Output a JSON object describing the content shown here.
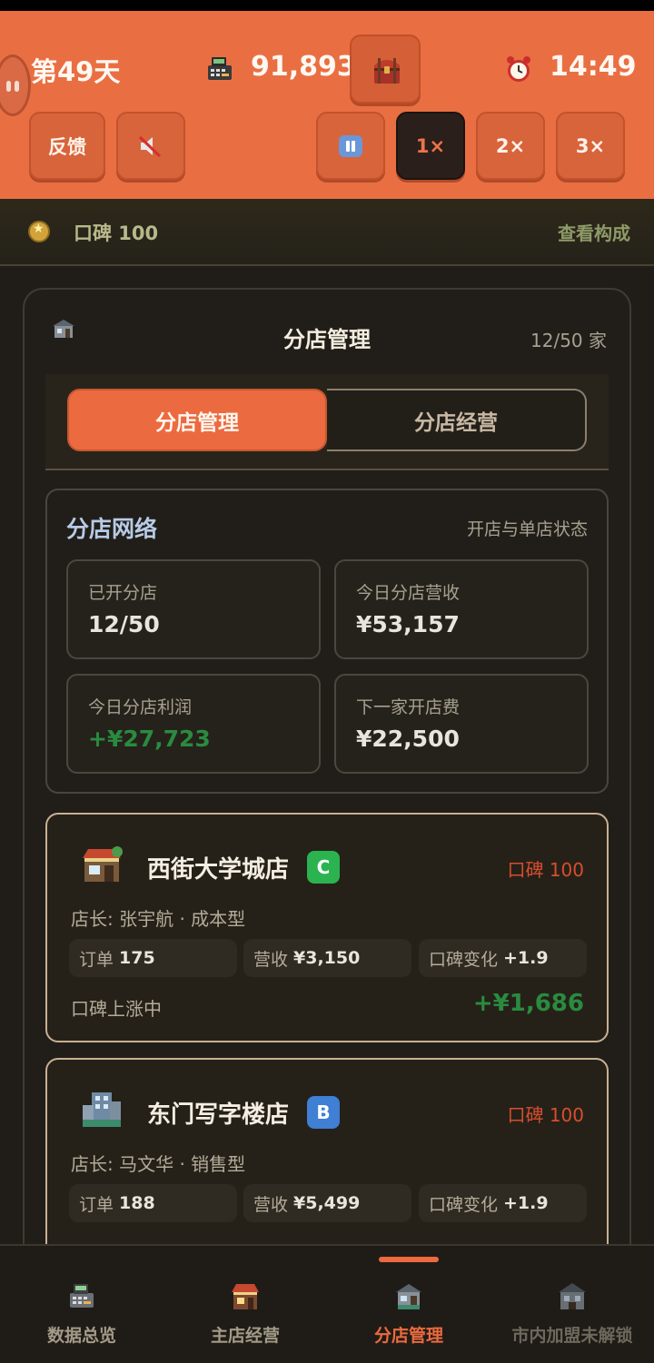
{
  "header": {
    "day": "第49天",
    "money": "91,893",
    "time": "14:49",
    "feedback_label": "反馈",
    "speed_1x": "1×",
    "speed_2x": "2×",
    "speed_3x": "3×"
  },
  "reputation": {
    "label": "口碑 100",
    "link": "查看构成"
  },
  "panel": {
    "title": "分店管理",
    "count": "12/50 家",
    "tabs": [
      "分店管理",
      "分店经营"
    ]
  },
  "network": {
    "title": "分店网络",
    "subtitle": "开店与单店状态",
    "stats": [
      {
        "label": "已开分店",
        "value": "12/50"
      },
      {
        "label": "今日分店营收",
        "value": "¥53,157"
      },
      {
        "label": "今日分店利润",
        "value": "+¥27,723"
      },
      {
        "label": "下一家开店费",
        "value": "¥22,500"
      }
    ]
  },
  "stores": [
    {
      "name": "西街大学城店",
      "grade": "C",
      "reputation": "口碑 100",
      "manager": "店长: 张宇航 · 成本型",
      "orders_label": "订单",
      "orders": "175",
      "revenue_label": "营收",
      "revenue": "¥3,150",
      "rep_change_label": "口碑变化",
      "rep_change": "+1.9",
      "trend": "口碑上涨中",
      "profit": "+¥1,686"
    },
    {
      "name": "东门写字楼店",
      "grade": "B",
      "reputation": "口碑 100",
      "manager": "店长: 马文华 · 销售型",
      "orders_label": "订单",
      "orders": "188",
      "revenue_label": "营收",
      "revenue": "¥5,499",
      "rep_change_label": "口碑变化",
      "rep_change": "+1.9"
    }
  ],
  "nav": [
    {
      "label": "数据总览",
      "icon": "cash-register-icon"
    },
    {
      "label": "主店经营",
      "icon": "shop-icon"
    },
    {
      "label": "分店管理",
      "icon": "branch-store-icon"
    },
    {
      "label": "市内加盟未解锁",
      "icon": "franchise-icon"
    }
  ],
  "colors": {
    "accent": "#ec6a3f",
    "header_bg": "#e96f43",
    "profit_green": "#2a8b3f",
    "reputation_red": "#d74e2c",
    "grade_c": "#2bb34f",
    "grade_b": "#3f7fd4"
  }
}
